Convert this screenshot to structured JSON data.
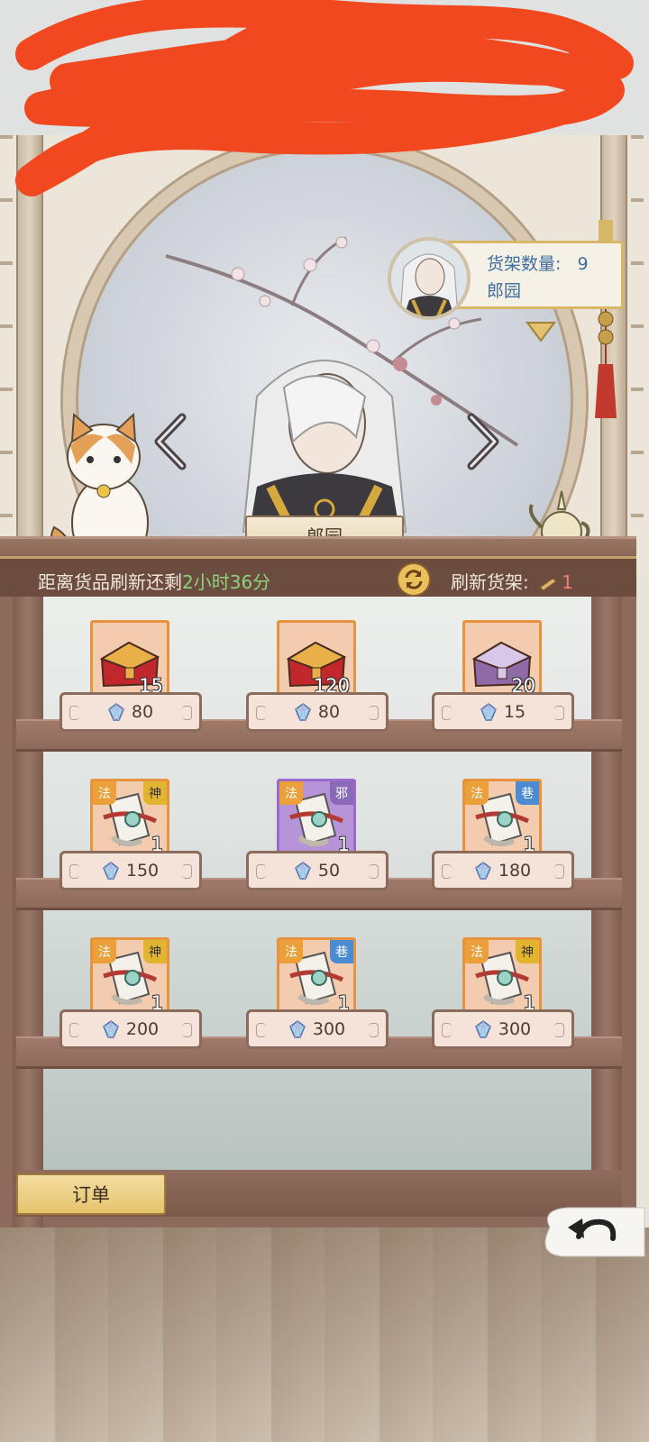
{
  "shelf_info": {
    "count_label": "货架数量:",
    "count_value": "9",
    "owner_name": "郎园"
  },
  "character": {
    "name": "郎园"
  },
  "refresh_bar": {
    "prefix": "距离货品刷新还剩",
    "time": "2小时36分",
    "refresh_label": "刷新货架:",
    "refresh_cost": "1"
  },
  "items": [
    {
      "qty": "15",
      "price": "80",
      "kind": "chest-red"
    },
    {
      "qty": "120",
      "price": "80",
      "kind": "chest-red"
    },
    {
      "qty": "20",
      "price": "15",
      "kind": "chest-purple"
    },
    {
      "qty": "1",
      "price": "150",
      "kind": "book",
      "tag_left": "法",
      "tag_right": "神"
    },
    {
      "qty": "1",
      "price": "50",
      "kind": "book",
      "tag_left": "法",
      "tag_right": "邪"
    },
    {
      "qty": "1",
      "price": "180",
      "kind": "book",
      "tag_left": "法",
      "tag_right": "巷"
    },
    {
      "qty": "1",
      "price": "200",
      "kind": "book",
      "tag_left": "法",
      "tag_right": "神"
    },
    {
      "qty": "1",
      "price": "300",
      "kind": "book",
      "tag_left": "法",
      "tag_right": "巷"
    },
    {
      "qty": "1",
      "price": "300",
      "kind": "book",
      "tag_left": "法",
      "tag_right": "神"
    }
  ],
  "buttons": {
    "order": "订单"
  },
  "icons": {
    "prev": "chevron-left-icon",
    "next": "chevron-right-icon",
    "refresh": "refresh-icon",
    "gem": "gem-icon",
    "back": "back-arrow-icon",
    "dropdown": "triangle-down-icon"
  },
  "colors": {
    "timer_green": "#8fd27e",
    "cost_red": "#f37b7b",
    "info_text_blue": "#3f6e9e",
    "gold_accent": "#e6c46e"
  }
}
